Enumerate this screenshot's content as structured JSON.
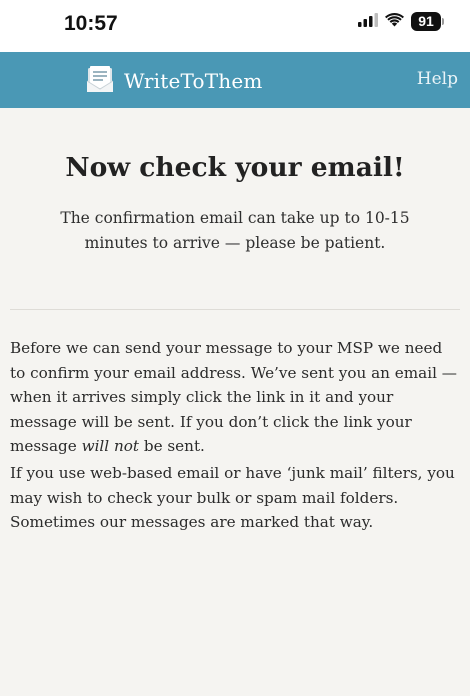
{
  "status_bar": {
    "time": "10:57",
    "battery": "91",
    "icons": [
      "cellular-signal-icon",
      "wifi-icon",
      "battery-icon"
    ]
  },
  "header": {
    "brand_name": "WriteToThem",
    "help_label": "Help",
    "background_color": "#4a98b5",
    "logo_icon": "document-icon"
  },
  "main": {
    "title": "Now check your email!",
    "subtitle": "The confirmation email can take up to 10-15 minutes to arrive — please be patient.",
    "paragraph_1": {
      "before_emphasis": "Before we can send your message to your MSP we need to confirm your email address. We’ve sent you an email — when it arrives simply click the link in it and your message will be sent. If you don’t click the link your message ",
      "emphasis": "will not",
      "after_emphasis": " be sent."
    },
    "paragraph_2": "If you use web-based email or have ‘junk mail’ filters, you may wish to check your bulk or spam mail folders. Sometimes our messages are marked that way."
  }
}
